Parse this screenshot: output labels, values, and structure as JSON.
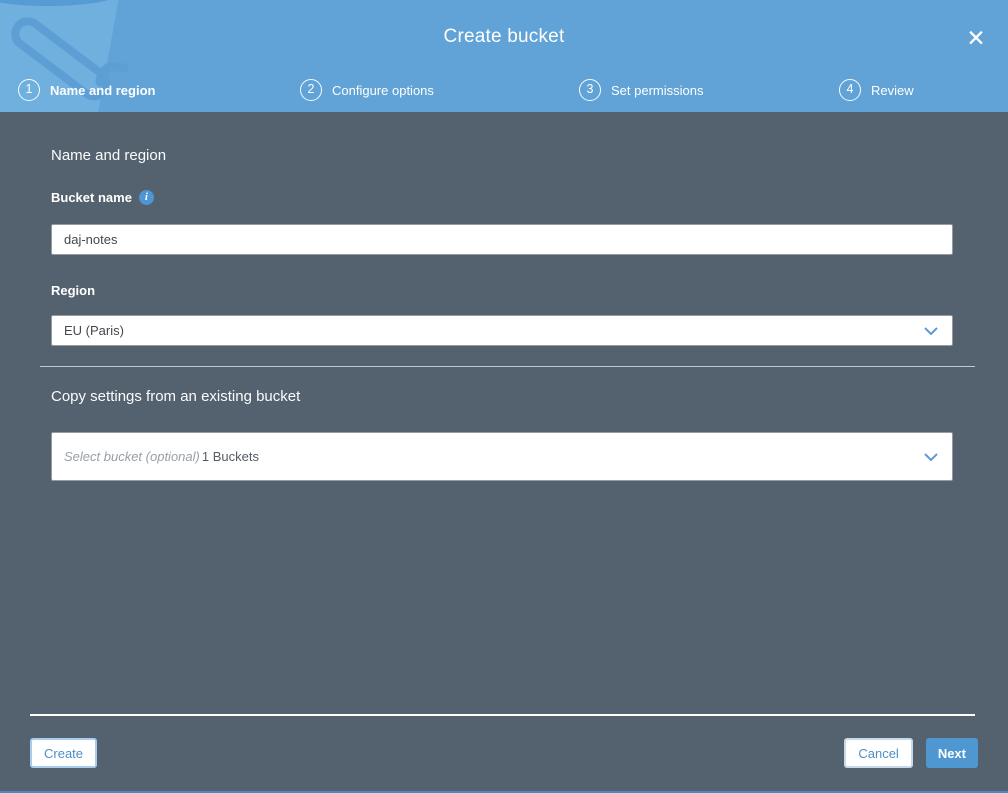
{
  "window": {
    "title": "Create bucket"
  },
  "icons": {
    "close": "✕",
    "info": "i",
    "chevron_down": "chevron-down",
    "bucket_watermark": "s3-bucket"
  },
  "colors": {
    "header_blue": "#61A3D6",
    "body_background": "#54626F",
    "accent_blue": "#4E8FC7",
    "next_button_blue": "#4F97D1",
    "info_icon_blue": "#4E96D4",
    "chevron_blue": "#5C9BD8"
  },
  "steps": [
    {
      "number": "1",
      "label": "Name and region",
      "active": true
    },
    {
      "number": "2",
      "label": "Configure options",
      "active": false
    },
    {
      "number": "3",
      "label": "Set permissions",
      "active": false
    },
    {
      "number": "4",
      "label": "Review",
      "active": false
    }
  ],
  "form": {
    "section_heading": "Name and region",
    "bucket_name": {
      "label": "Bucket name",
      "value": "daj-notes"
    },
    "region": {
      "label": "Region",
      "selected": "EU (Paris)"
    },
    "copy_settings": {
      "heading": "Copy settings from an existing bucket",
      "placeholder": "Select bucket (optional)",
      "count": "1 Buckets"
    }
  },
  "footer": {
    "create_label": "Create",
    "cancel_label": "Cancel",
    "next_label": "Next"
  }
}
